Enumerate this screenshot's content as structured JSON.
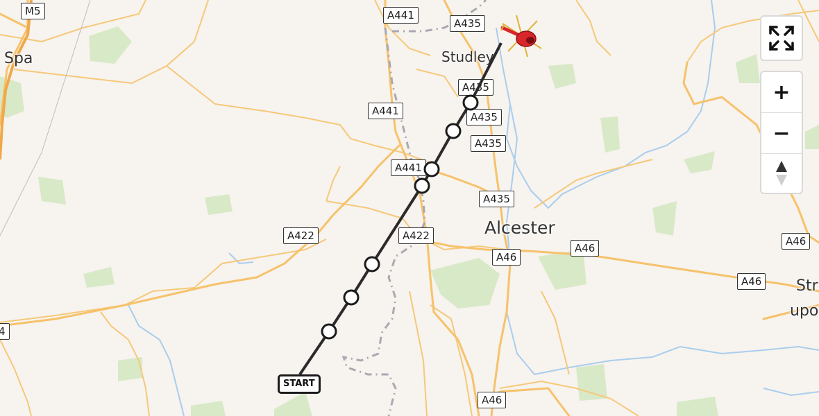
{
  "map": {
    "places": {
      "spa": "Spa",
      "studley": "Studley",
      "alcester": "Alcester",
      "str": "Str",
      "upo": "upo"
    },
    "road_labels": {
      "m5": "M5",
      "a441_top": "A441",
      "a435_top": "A435",
      "a435_1": "A435",
      "a435_2": "A435",
      "a435_3": "A435",
      "a441_mid": "A441",
      "a441_lower": "A441",
      "a435_alcester": "A435",
      "a422_left": "A422",
      "a422_mid": "A422",
      "a46_1": "A46",
      "a46_2": "A46",
      "a46_3": "A46",
      "a46_right": "A46",
      "a46_bottom": "A46",
      "left_edge": "4"
    },
    "route": {
      "start_label": "START",
      "waypoint_count": 8
    },
    "destination_icon": "helicopter-icon",
    "controls": {
      "fullscreen_icon": "fullscreen-icon",
      "zoom_in": "+",
      "zoom_out": "−",
      "compass_icon": "compass-icon"
    },
    "colors": {
      "background": "#f7f3ee",
      "road": "#f6c26b",
      "water": "#9ec6ec",
      "green": "#d6e8c7",
      "route_line": "#2b2b2b",
      "helicopter": "#d9262b"
    }
  }
}
